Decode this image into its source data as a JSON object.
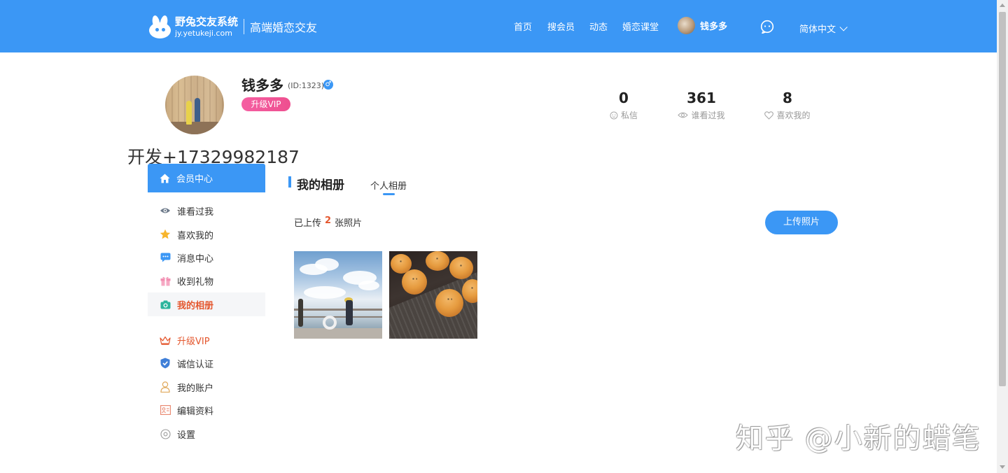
{
  "header": {
    "logo_name": "野兔交友系统",
    "logo_domain": "jy.yetukeji.com",
    "slogan": "高端婚恋交友",
    "nav": [
      "首页",
      "搜会员",
      "动态",
      "婚恋课堂"
    ],
    "username": "钱多多",
    "language": "简体中文",
    "accent_color": "#3b97f5"
  },
  "profile": {
    "name": "钱多多",
    "id_text": "(ID:1323)",
    "gender_symbol": "♂",
    "vip_badge": "升级VIP",
    "stats": [
      {
        "value": "0",
        "label": "私信",
        "icon": "chat-face-icon"
      },
      {
        "value": "361",
        "label": "谁看过我",
        "icon": "eye-icon"
      },
      {
        "value": "8",
        "label": "喜欢我的",
        "icon": "heart-icon"
      }
    ]
  },
  "dev_text": "开发+17329982187",
  "sidebar": {
    "header": "会员中心",
    "items": [
      {
        "label": "谁看过我",
        "icon": "eye-icon"
      },
      {
        "label": "喜欢我的",
        "icon": "star-icon"
      },
      {
        "label": "消息中心",
        "icon": "message-icon"
      },
      {
        "label": "收到礼物",
        "icon": "gift-icon"
      },
      {
        "label": "我的相册",
        "icon": "camera-icon"
      },
      {
        "label": "升级VIP",
        "icon": "crown-icon"
      },
      {
        "label": "诚信认证",
        "icon": "shield-icon"
      },
      {
        "label": "我的账户",
        "icon": "user-icon"
      },
      {
        "label": "编辑资料",
        "icon": "edit-profile-icon"
      },
      {
        "label": "设置",
        "icon": "settings-icon"
      }
    ]
  },
  "album": {
    "title": "我的相册",
    "tab": "个人相册",
    "upload_prefix": "已上传",
    "upload_count": "2",
    "upload_suffix": "张照片",
    "upload_button": "上传照片"
  },
  "watermark": "知乎 @小新的蜡笔"
}
